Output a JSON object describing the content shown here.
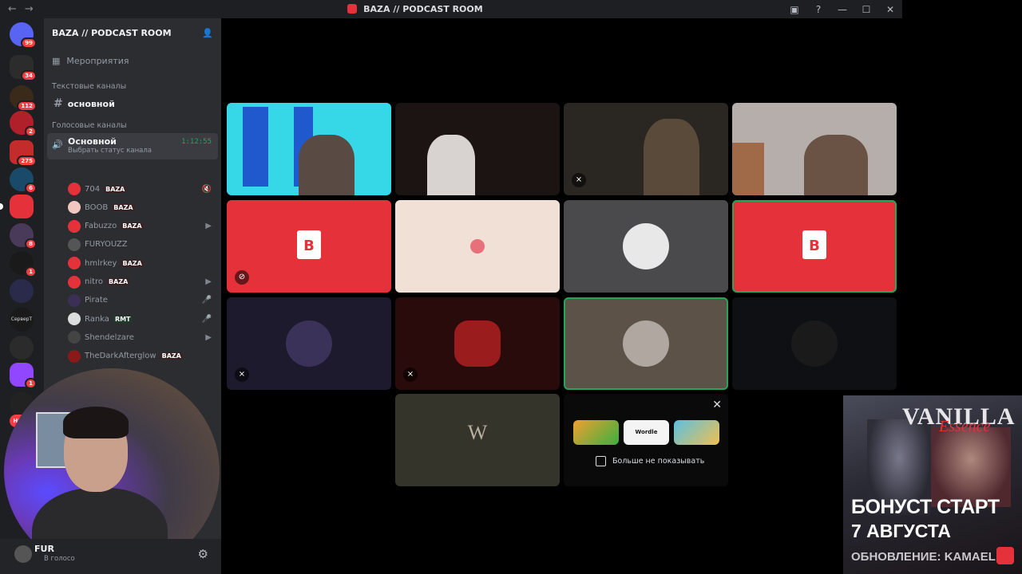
{
  "window": {
    "title": "BAZA // PODCAST ROOM",
    "back_icon": "←",
    "forward_icon": "→",
    "controls": [
      "▣",
      "?",
      "—",
      "☐",
      "✕"
    ]
  },
  "server_rail": {
    "badges": [
      "99",
      "34",
      "112",
      "2",
      "275",
      "6",
      "8",
      "1",
      "1",
      "1",
      "НОВ"
    ],
    "label_small": "СерверТ"
  },
  "sidebar": {
    "server_name": "BAZA // PODCAST ROOM",
    "events_label": "Мероприятия",
    "text_category": "Текстовые каналы",
    "text_channel": "основной",
    "voice_category": "Голосовые каналы",
    "voice_channel": {
      "name": "Основной",
      "status": "Выбрать статус канала",
      "elapsed": "1:12:55"
    },
    "members": [
      {
        "name": "704",
        "tag": "BAZA",
        "color": "#e5323a",
        "state": "🔇"
      },
      {
        "name": "BOOB",
        "tag": "BAZA",
        "color": "#f0c8c0",
        "state": ""
      },
      {
        "name": "Fabuzzo",
        "tag": "BAZA",
        "color": "#e5323a",
        "state": "▶"
      },
      {
        "name": "FURYOUZZ",
        "tag": "",
        "color": "#555",
        "state": ""
      },
      {
        "name": "hmlrkey",
        "tag": "BAZA",
        "color": "#e5323a",
        "state": ""
      },
      {
        "name": "nitro",
        "tag": "BAZA",
        "color": "#e5323a",
        "state": "▶"
      },
      {
        "name": "Pirate",
        "tag": "",
        "color": "#3a3056",
        "state": "🎤"
      },
      {
        "name": "Ranka",
        "tag": "RMT",
        "color": "#ddd",
        "state": "🎤"
      },
      {
        "name": "Shendelzare",
        "tag": "",
        "color": "#444",
        "state": "▶"
      },
      {
        "name": "TheDarkAfterglow",
        "tag": "BAZA",
        "color": "#8a1a1a",
        "state": ""
      }
    ]
  },
  "user_panel": {
    "name": "FUR",
    "status": "В голосо",
    "settings_icon": "⚙"
  },
  "promo": {
    "close": "✕",
    "apps": [
      "",
      "Wordle",
      ""
    ],
    "checkbox_label": "Больше не показывать"
  },
  "ad": {
    "brand": "VANILLA",
    "brand_script": "Essence",
    "line1": "БОНУСТ СТАРТ",
    "line2": "7 АВГУСТА",
    "line3": "ОБНОВЛЕНИЕ: KAMAEL"
  },
  "colors": {
    "accent_red": "#e5323a",
    "speaking_green": "#23a55a"
  }
}
